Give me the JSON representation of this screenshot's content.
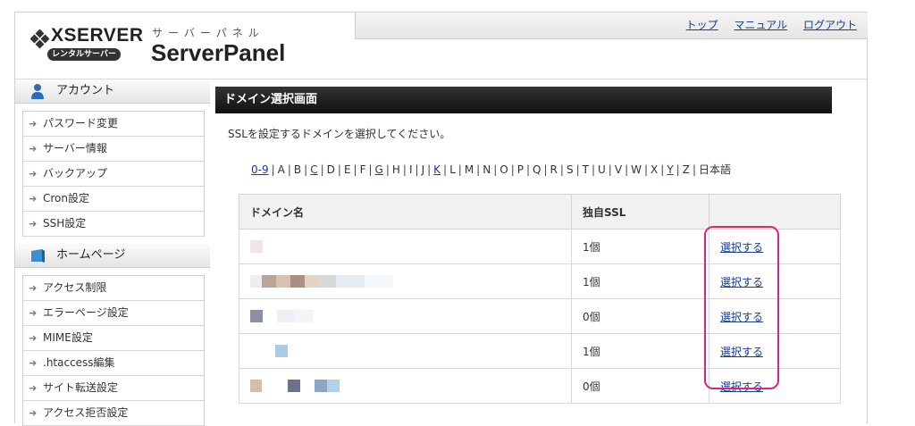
{
  "header": {
    "logo_text": "XSERVER",
    "logo_badge": "レンタルサーバー",
    "panel_kana": "サーバーパネル",
    "panel_title": "ServerPanel",
    "nav": [
      "トップ",
      "マニュアル",
      "ログアウト"
    ]
  },
  "sidebar": {
    "account": {
      "title": "アカウント",
      "items": [
        "パスワード変更",
        "サーバー情報",
        "バックアップ",
        "Cron設定",
        "SSH設定"
      ]
    },
    "homepage": {
      "title": "ホームページ",
      "items": [
        "アクセス制限",
        "エラーページ設定",
        "MIME設定",
        ".htaccess編集",
        "サイト転送設定",
        "アクセス拒否設定"
      ]
    }
  },
  "main": {
    "title": "ドメイン選択画面",
    "intro": "SSLを設定するドメインを選択してください。",
    "alpha_index": [
      {
        "label": "0-9",
        "link": true
      },
      {
        "label": "A",
        "link": false
      },
      {
        "label": "B",
        "link": false
      },
      {
        "label": "C",
        "link": true
      },
      {
        "label": "D",
        "link": false
      },
      {
        "label": "E",
        "link": false
      },
      {
        "label": "F",
        "link": false
      },
      {
        "label": "G",
        "link": true
      },
      {
        "label": "H",
        "link": false
      },
      {
        "label": "I",
        "link": false
      },
      {
        "label": "J",
        "link": false
      },
      {
        "label": "K",
        "link": true
      },
      {
        "label": "L",
        "link": false
      },
      {
        "label": "M",
        "link": false
      },
      {
        "label": "N",
        "link": false
      },
      {
        "label": "O",
        "link": false
      },
      {
        "label": "P",
        "link": false
      },
      {
        "label": "Q",
        "link": false
      },
      {
        "label": "R",
        "link": false
      },
      {
        "label": "S",
        "link": false
      },
      {
        "label": "T",
        "link": false
      },
      {
        "label": "U",
        "link": false
      },
      {
        "label": "V",
        "link": false
      },
      {
        "label": "W",
        "link": false
      },
      {
        "label": "X",
        "link": false
      },
      {
        "label": "Y",
        "link": true
      },
      {
        "label": "Z",
        "link": false
      },
      {
        "label": "日本語",
        "link": false
      }
    ],
    "table": {
      "headers": [
        "ドメイン名",
        "独自SSL",
        ""
      ],
      "rows": [
        {
          "ssl": "1個",
          "action": "選択する"
        },
        {
          "ssl": "1個",
          "action": "選択する"
        },
        {
          "ssl": "0個",
          "action": "選択する"
        },
        {
          "ssl": "1個",
          "action": "選択する"
        },
        {
          "ssl": "0個",
          "action": "選択する"
        }
      ]
    }
  },
  "colors": {
    "link": "#1a3d8f",
    "title_bar": "#222222",
    "highlight": "#d6287a"
  }
}
